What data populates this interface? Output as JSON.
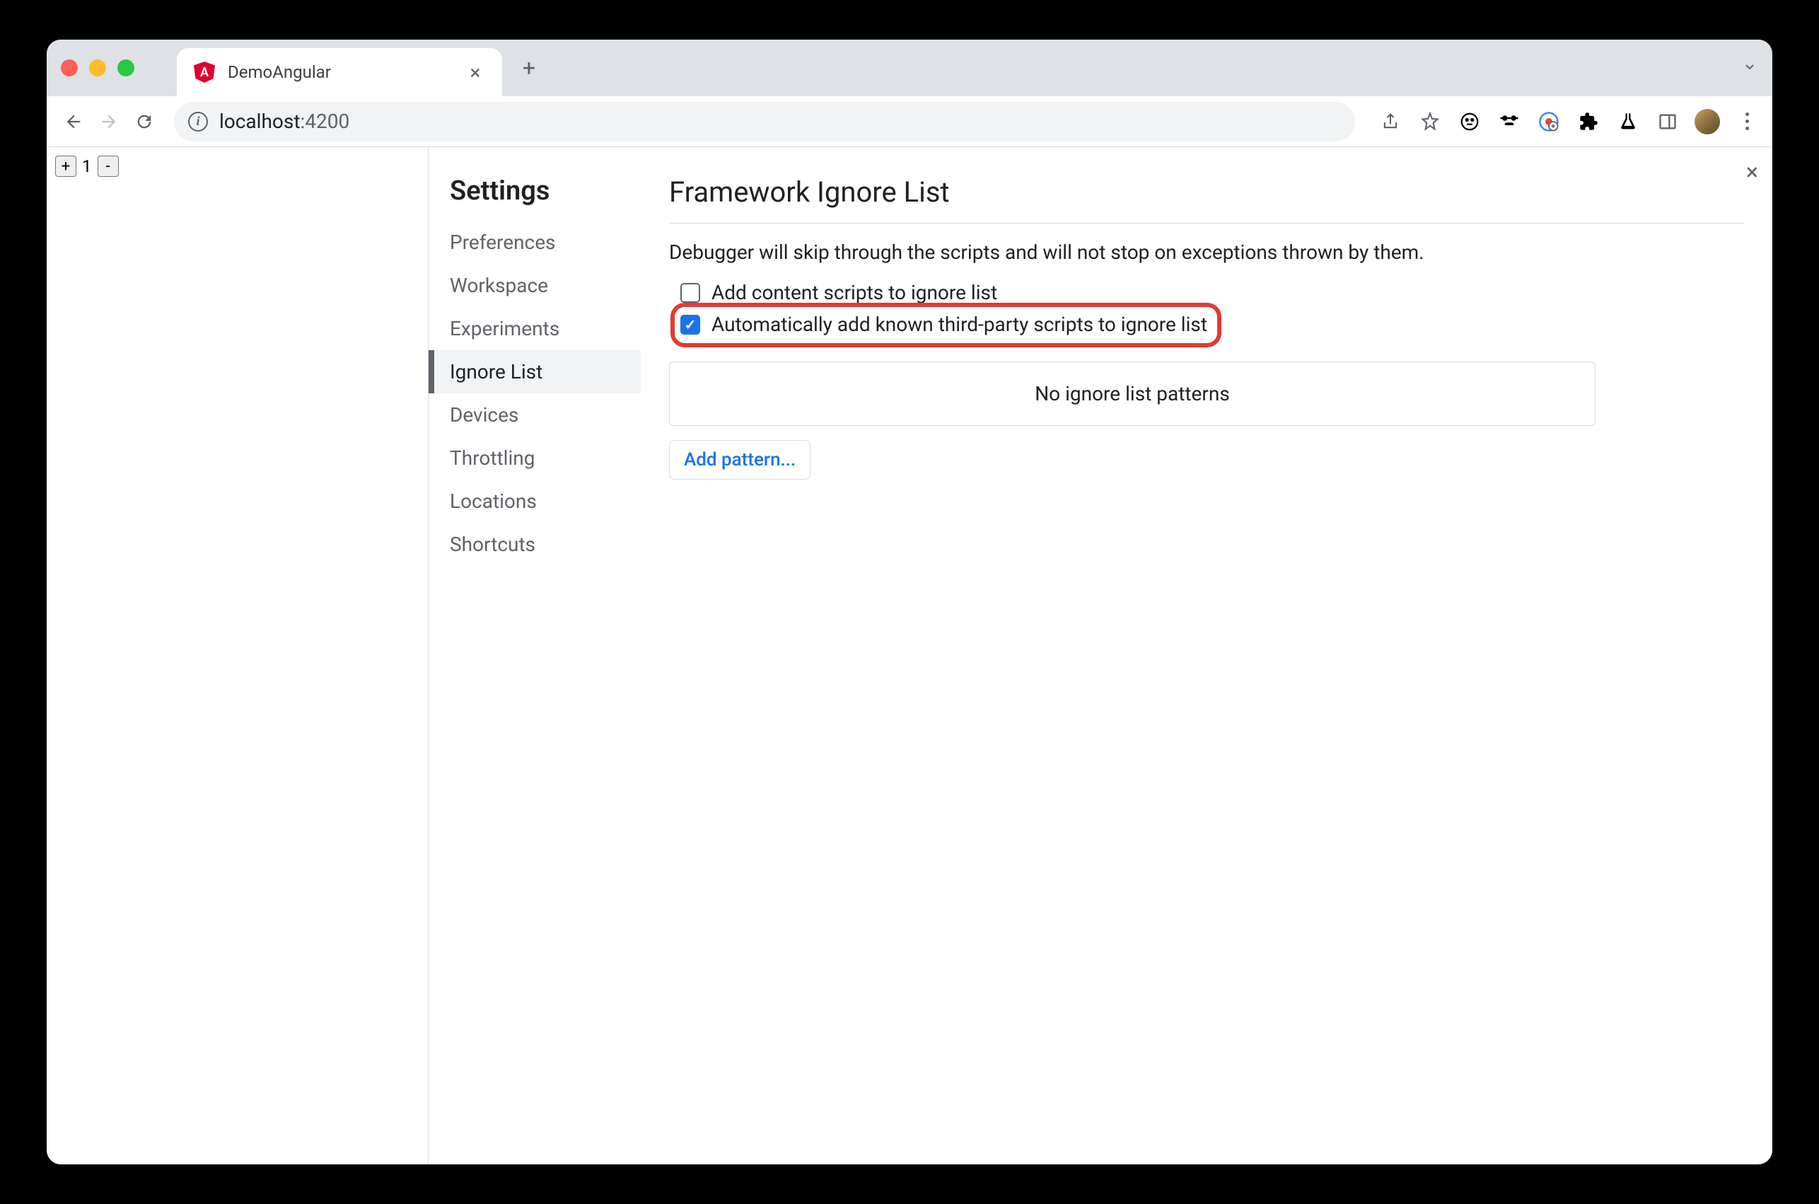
{
  "browser": {
    "tab_title": "DemoAngular",
    "url_host": "localhost",
    "url_port": ":4200"
  },
  "page": {
    "counter_value": "1",
    "plus_label": "+",
    "minus_label": "-"
  },
  "settings": {
    "title": "Settings",
    "nav_items": [
      "Preferences",
      "Workspace",
      "Experiments",
      "Ignore List",
      "Devices",
      "Throttling",
      "Locations",
      "Shortcuts"
    ],
    "active_index": 3
  },
  "panel": {
    "title": "Framework Ignore List",
    "description": "Debugger will skip through the scripts and will not stop on exceptions thrown by them.",
    "checkbox1_label": "Add content scripts to ignore list",
    "checkbox1_checked": false,
    "checkbox2_label": "Automatically add known third-party scripts to ignore list",
    "checkbox2_checked": true,
    "empty_patterns": "No ignore list patterns",
    "add_pattern_label": "Add pattern..."
  }
}
